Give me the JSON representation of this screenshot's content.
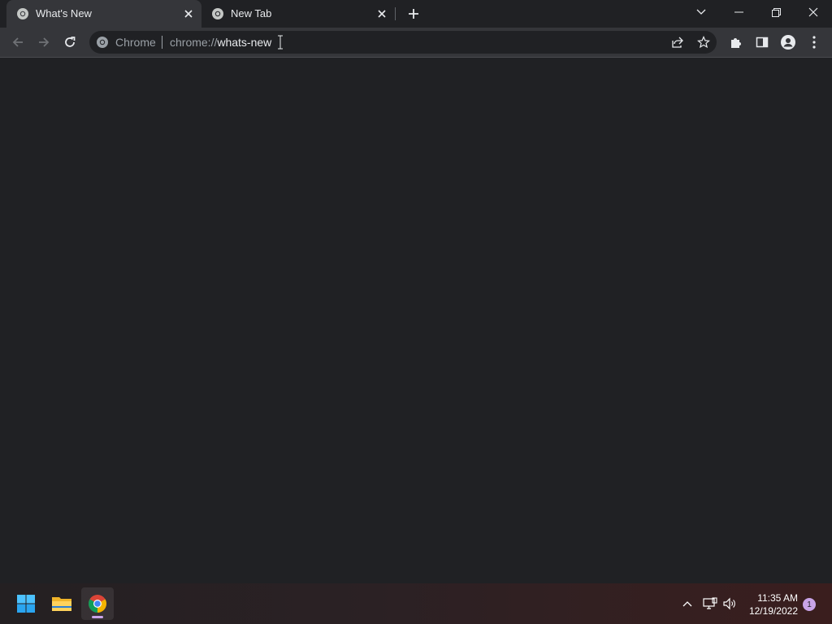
{
  "browser": {
    "tabs": [
      {
        "title": "What's New",
        "active": true,
        "icon": "chrome-icon"
      },
      {
        "title": "New Tab",
        "active": false,
        "icon": "chrome-icon"
      }
    ],
    "omnibox": {
      "site_label": "Chrome",
      "url_scheme": "chrome://",
      "url_host": "whats-new"
    }
  },
  "taskbar": {
    "time": "11:35 AM",
    "date": "12/19/2022",
    "notification_count": "1"
  },
  "colors": {
    "background": "#202124",
    "toolbar": "#35363a",
    "accent": "#c9a4e8"
  }
}
